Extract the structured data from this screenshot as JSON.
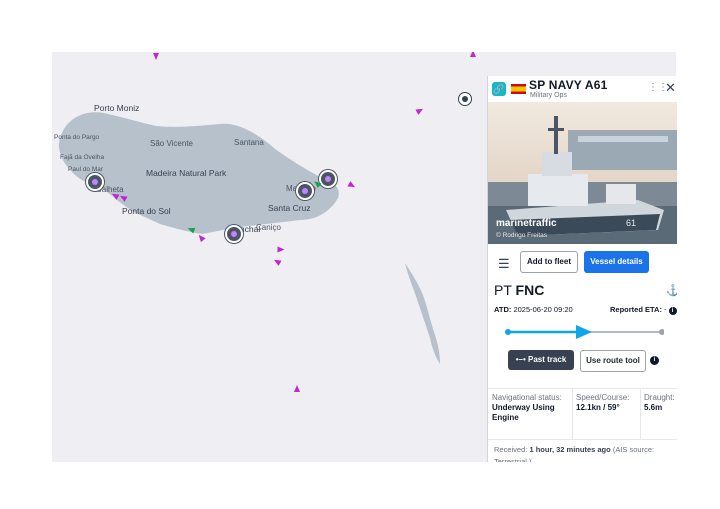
{
  "map": {
    "places": [
      {
        "id": "porto-moniz",
        "label": "Porto Moniz"
      },
      {
        "id": "ponta-do-pargo",
        "label": "Ponta do Pargo"
      },
      {
        "id": "sao-vicente",
        "label": "São Vicente"
      },
      {
        "id": "santana",
        "label": "Santana"
      },
      {
        "id": "faja-da-ovelha",
        "label": "Fajã da Ovelha"
      },
      {
        "id": "paul-do-mar",
        "label": "Paul do Mar"
      },
      {
        "id": "madeira-natural-park",
        "label": "Madeira Natural Park"
      },
      {
        "id": "calheta",
        "label": "Calheta"
      },
      {
        "id": "machico",
        "label": "Machico"
      },
      {
        "id": "ponta-do-sol",
        "label": "Ponta do Sol"
      },
      {
        "id": "santa-cruz",
        "label": "Santa Cruz"
      },
      {
        "id": "funchal",
        "label": "Funchal"
      },
      {
        "id": "canico",
        "label": "Caniço"
      }
    ]
  },
  "panel": {
    "vessel_name": "SP NAVY A61",
    "vessel_type": "Military Ops",
    "flag": "spain",
    "photo_watermark": "marinetraffic",
    "photo_credit": "© Rodrigo Freitas",
    "add_to_fleet_label": "Add to fleet",
    "vessel_details_label": "Vessel details",
    "destination_prefix": "PT",
    "destination_code": "FNC",
    "atd_label": "ATD:",
    "atd_value": "2025-06-20 09:20",
    "eta_label": "Reported ETA:",
    "eta_value": "-",
    "past_track_label": "Past track",
    "route_tool_label": "Use route tool",
    "nav_status_label": "Navigational status:",
    "nav_status_value": "Underway Using Engine",
    "speed_label": "Speed/Course:",
    "speed_value": "12.1kn / 59°",
    "draught_label": "Draught:",
    "draught_value": "5.6m",
    "received_label": "Received:",
    "received_value": "1 hour, 32 minutes ago",
    "received_source": "(AIS source: Terrestrial )",
    "accent_color": "#1a73e8",
    "route_color": "#0ea5e9"
  }
}
